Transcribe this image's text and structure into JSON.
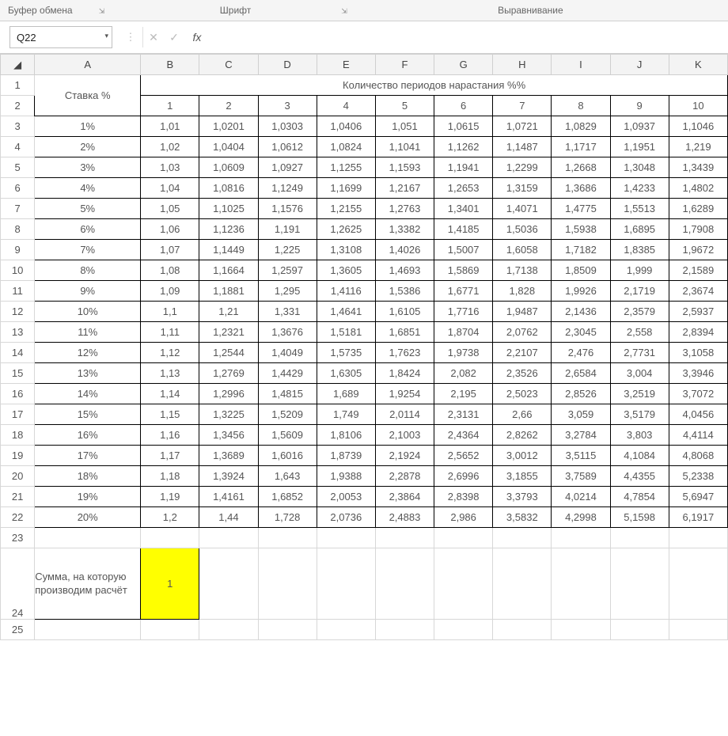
{
  "ribbon": {
    "groups": {
      "clipboard": "Буфер обмена",
      "font": "Шрифт",
      "alignment": "Выравнивание"
    },
    "launcher_glyph": "⇲"
  },
  "fx": {
    "namebox": "Q22",
    "dropdown_glyph": "▾",
    "sep_glyph": "⋮",
    "cancel_glyph": "✕",
    "accept_glyph": "✓",
    "fx_label": "fx",
    "formula": ""
  },
  "columns": [
    "",
    "A",
    "B",
    "C",
    "D",
    "E",
    "F",
    "G",
    "H",
    "I",
    "J",
    "K"
  ],
  "row_numbers": [
    1,
    2,
    3,
    4,
    5,
    6,
    7,
    8,
    9,
    10,
    11,
    12,
    13,
    14,
    15,
    16,
    17,
    18,
    19,
    20,
    21,
    22,
    23,
    24,
    25
  ],
  "merged_header": "Количество периодов нарастания %%",
  "stavka_label": "Ставка %",
  "periods": [
    "1",
    "2",
    "3",
    "4",
    "5",
    "6",
    "7",
    "8",
    "9",
    "10"
  ],
  "rates": [
    "1%",
    "2%",
    "3%",
    "4%",
    "5%",
    "6%",
    "7%",
    "8%",
    "9%",
    "10%",
    "11%",
    "12%",
    "13%",
    "14%",
    "15%",
    "16%",
    "17%",
    "18%",
    "19%",
    "20%"
  ],
  "values": [
    [
      "1,01",
      "1,0201",
      "1,0303",
      "1,0406",
      "1,051",
      "1,0615",
      "1,0721",
      "1,0829",
      "1,0937",
      "1,1046"
    ],
    [
      "1,02",
      "1,0404",
      "1,0612",
      "1,0824",
      "1,1041",
      "1,1262",
      "1,1487",
      "1,1717",
      "1,1951",
      "1,219"
    ],
    [
      "1,03",
      "1,0609",
      "1,0927",
      "1,1255",
      "1,1593",
      "1,1941",
      "1,2299",
      "1,2668",
      "1,3048",
      "1,3439"
    ],
    [
      "1,04",
      "1,0816",
      "1,1249",
      "1,1699",
      "1,2167",
      "1,2653",
      "1,3159",
      "1,3686",
      "1,4233",
      "1,4802"
    ],
    [
      "1,05",
      "1,1025",
      "1,1576",
      "1,2155",
      "1,2763",
      "1,3401",
      "1,4071",
      "1,4775",
      "1,5513",
      "1,6289"
    ],
    [
      "1,06",
      "1,1236",
      "1,191",
      "1,2625",
      "1,3382",
      "1,4185",
      "1,5036",
      "1,5938",
      "1,6895",
      "1,7908"
    ],
    [
      "1,07",
      "1,1449",
      "1,225",
      "1,3108",
      "1,4026",
      "1,5007",
      "1,6058",
      "1,7182",
      "1,8385",
      "1,9672"
    ],
    [
      "1,08",
      "1,1664",
      "1,2597",
      "1,3605",
      "1,4693",
      "1,5869",
      "1,7138",
      "1,8509",
      "1,999",
      "2,1589"
    ],
    [
      "1,09",
      "1,1881",
      "1,295",
      "1,4116",
      "1,5386",
      "1,6771",
      "1,828",
      "1,9926",
      "2,1719",
      "2,3674"
    ],
    [
      "1,1",
      "1,21",
      "1,331",
      "1,4641",
      "1,6105",
      "1,7716",
      "1,9487",
      "2,1436",
      "2,3579",
      "2,5937"
    ],
    [
      "1,11",
      "1,2321",
      "1,3676",
      "1,5181",
      "1,6851",
      "1,8704",
      "2,0762",
      "2,3045",
      "2,558",
      "2,8394"
    ],
    [
      "1,12",
      "1,2544",
      "1,4049",
      "1,5735",
      "1,7623",
      "1,9738",
      "2,2107",
      "2,476",
      "2,7731",
      "3,1058"
    ],
    [
      "1,13",
      "1,2769",
      "1,4429",
      "1,6305",
      "1,8424",
      "2,082",
      "2,3526",
      "2,6584",
      "3,004",
      "3,3946"
    ],
    [
      "1,14",
      "1,2996",
      "1,4815",
      "1,689",
      "1,9254",
      "2,195",
      "2,5023",
      "2,8526",
      "3,2519",
      "3,7072"
    ],
    [
      "1,15",
      "1,3225",
      "1,5209",
      "1,749",
      "2,0114",
      "2,3131",
      "2,66",
      "3,059",
      "3,5179",
      "4,0456"
    ],
    [
      "1,16",
      "1,3456",
      "1,5609",
      "1,8106",
      "2,1003",
      "2,4364",
      "2,8262",
      "3,2784",
      "3,803",
      "4,4114"
    ],
    [
      "1,17",
      "1,3689",
      "1,6016",
      "1,8739",
      "2,1924",
      "2,5652",
      "3,0012",
      "3,5115",
      "4,1084",
      "4,8068"
    ],
    [
      "1,18",
      "1,3924",
      "1,643",
      "1,9388",
      "2,2878",
      "2,6996",
      "3,1855",
      "3,7589",
      "4,4355",
      "5,2338"
    ],
    [
      "1,19",
      "1,4161",
      "1,6852",
      "2,0053",
      "2,3864",
      "2,8398",
      "3,3793",
      "4,0214",
      "4,7854",
      "5,6947"
    ],
    [
      "1,2",
      "1,44",
      "1,728",
      "2,0736",
      "2,4883",
      "2,986",
      "3,5832",
      "4,2998",
      "5,1598",
      "6,1917"
    ]
  ],
  "sum_label": "Сумма, на которую производим расчёт",
  "sum_value": "1",
  "selected_cell": "Q22"
}
